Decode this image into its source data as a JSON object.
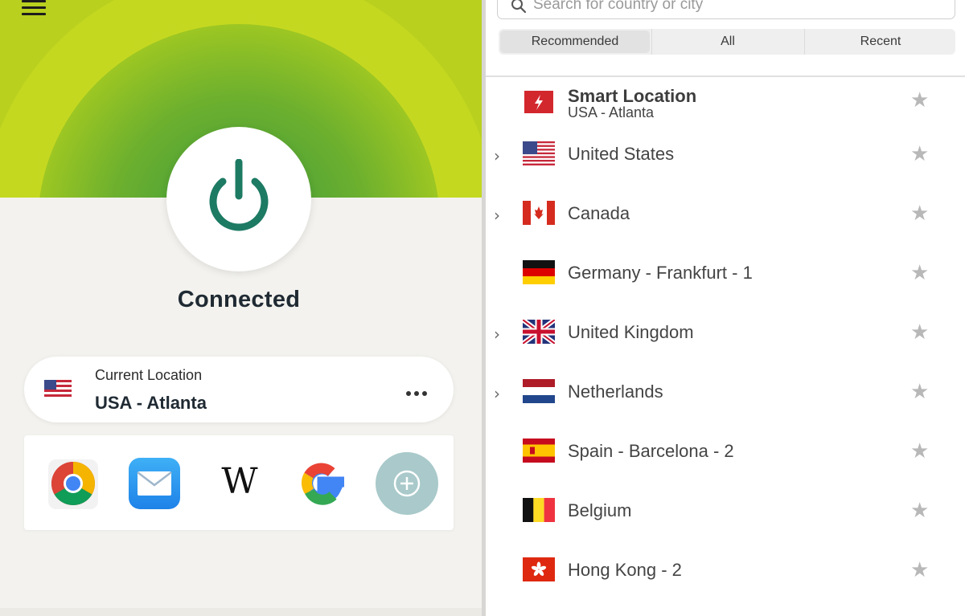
{
  "connection": {
    "status": "Connected",
    "location_caption": "Current Location",
    "location_value": "USA - Atlanta"
  },
  "shortcuts": [
    {
      "name": "Chrome",
      "icon": "chrome-icon"
    },
    {
      "name": "Mail",
      "icon": "mail-icon"
    },
    {
      "name": "Wikipedia",
      "icon": "wikipedia-icon",
      "glyph": "W"
    },
    {
      "name": "Google",
      "icon": "google-icon"
    },
    {
      "name": "Add shortcut",
      "icon": "add-icon"
    }
  ],
  "search": {
    "placeholder": "Search for country or city"
  },
  "tabs": [
    "Recommended",
    "All",
    "Recent"
  ],
  "active_tab": "Recommended",
  "smart_location": {
    "title": "Smart Location",
    "subtitle": "USA - Atlanta"
  },
  "locations": [
    {
      "name": "United States",
      "flag": "us-flag",
      "expandable": true
    },
    {
      "name": "Canada",
      "flag": "canada-flag",
      "expandable": true
    },
    {
      "name": "Germany - Frankfurt - 1",
      "flag": "germany-flag",
      "expandable": false
    },
    {
      "name": "United Kingdom",
      "flag": "uk-flag",
      "expandable": true
    },
    {
      "name": "Netherlands",
      "flag": "netherlands-flag",
      "expandable": true
    },
    {
      "name": "Spain - Barcelona - 2",
      "flag": "spain-flag",
      "expandable": false
    },
    {
      "name": "Belgium",
      "flag": "belgium-flag",
      "expandable": false
    },
    {
      "name": "Hong Kong - 2",
      "flag": "hong-kong-flag",
      "expandable": false
    }
  ],
  "colors": {
    "accent": "#b9d01e",
    "power_icon": "#1d7a63",
    "star": "#b8b8b8"
  }
}
